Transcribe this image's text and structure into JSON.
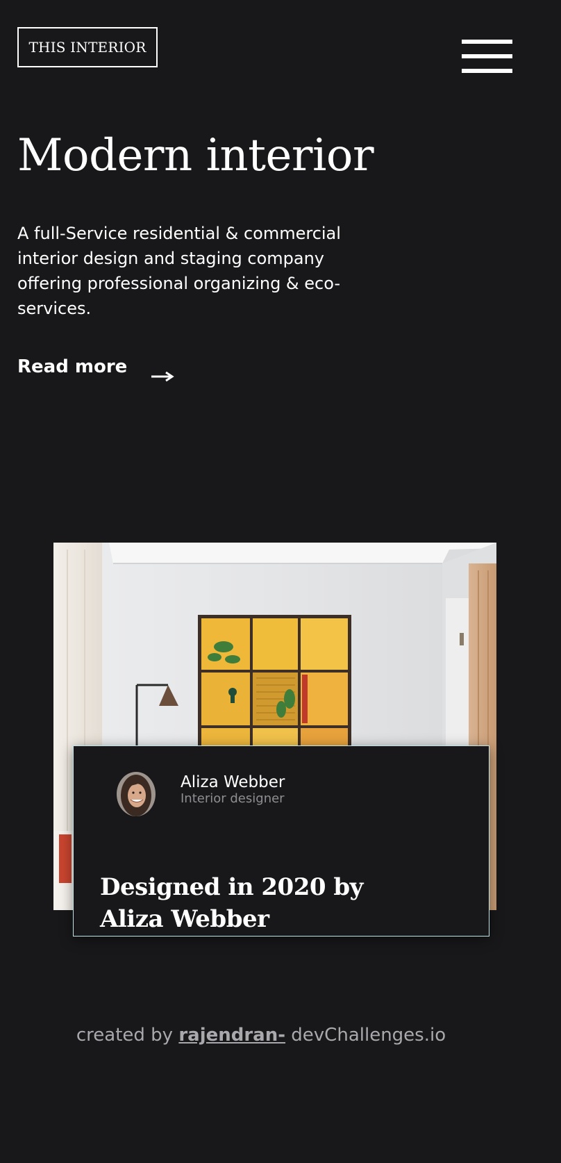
{
  "header": {
    "logo_text": "THIS INTERIOR",
    "menu_icon": "hamburger-menu-icon"
  },
  "hero": {
    "title": "Modern interior",
    "description": "A full-Service residential & commercial interior design and staging company offering professional organizing & eco-services.",
    "read_more_label": "Read more",
    "read_more_icon": "arrow-right-icon"
  },
  "feature": {
    "designer_name": "Aliza Webber",
    "designer_role": "Interior designer",
    "card_title": "Designed in 2020 by Aliza Webber"
  },
  "footer": {
    "prefix": "created by",
    "author": "rajendran-",
    "suffix": "devChallenges.io"
  },
  "colors": {
    "background": "#18181a",
    "text": "#ffffff",
    "muted_text": "#8f8f93",
    "card_border": "#bfe3e6",
    "footer_text": "#a9a9ad"
  }
}
